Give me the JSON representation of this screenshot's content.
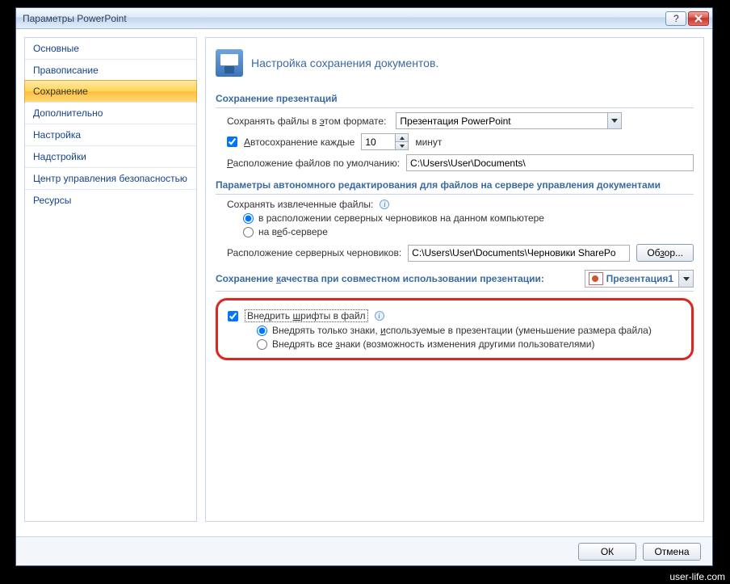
{
  "window": {
    "title": "Параметры PowerPoint"
  },
  "nav": {
    "items": [
      "Основные",
      "Правописание",
      "Сохранение",
      "Дополнительно",
      "Настройка",
      "Надстройки",
      "Центр управления безопасностью",
      "Ресурсы"
    ],
    "selected": 2
  },
  "header": {
    "text": "Настройка сохранения документов."
  },
  "section1": {
    "title": "Сохранение презентаций",
    "format_label_pre": "Сохранять файлы в ",
    "format_label_u": "э",
    "format_label_post": "том формате:",
    "format_value": "Презентация PowerPoint",
    "autosave_checked": true,
    "autosave_label_u": "А",
    "autosave_label_post": "втосохранение каждые",
    "autosave_value": "10",
    "autosave_unit": "минут",
    "defaultloc_label_u": "Р",
    "defaultloc_label_post": "асположение файлов по умолчанию:",
    "defaultloc_value": "C:\\Users\\User\\Documents\\"
  },
  "section2": {
    "title": "Параметры автономного редактирования для файлов на сервере управления документами",
    "extract_label": "Сохранять извлеченные файлы:",
    "radio1": "в расположении серверных черновиков на данном компьютере",
    "radio2_pre": "на в",
    "radio2_u": "е",
    "radio2_post": "б-сервере",
    "drafts_label": "Расположение серверных черновиков:",
    "drafts_value": "C:\\Users\\User\\Documents\\Черновики SharePo",
    "browse_pre": "Об",
    "browse_u": "з",
    "browse_post": "ор..."
  },
  "section3": {
    "title_pre": "Сохранение ",
    "title_u": "к",
    "title_post": "ачества при совместном использовании презентации:",
    "doc_name": "Презентация1"
  },
  "embed": {
    "checked": true,
    "label_pre": "Внедрить ",
    "label_u": "ш",
    "label_post": "рифты в файл",
    "radio1_pre": "Внедрять только знаки, ",
    "radio1_u": "и",
    "radio1_post": "спользуемые в презентации (уменьшение размера файла)",
    "radio2_pre": "Внедрять все ",
    "radio2_u": "з",
    "radio2_post": "наки (возможность изменения другими пользователями)"
  },
  "buttons": {
    "ok": "ОК",
    "cancel": "Отмена"
  },
  "watermark": "user-life.com"
}
